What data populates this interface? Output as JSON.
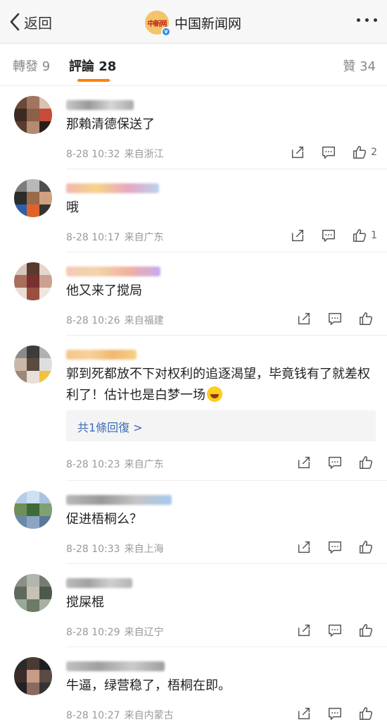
{
  "nav": {
    "back_label": "返回",
    "title": "中国新闻网",
    "logo_text": "中新网"
  },
  "tabs": {
    "repost": "轉發 9",
    "comments": "評論 28",
    "likes": "贊 34"
  },
  "colors": {
    "accent": "#ff8200",
    "link": "#3b6cb7",
    "verified": "#2f8fe6"
  },
  "comments": [
    {
      "text": "那賴清德保送了",
      "time": "8-28 10:32",
      "location": "来自浙江",
      "likes": "2"
    },
    {
      "text": "哦",
      "time": "8-28 10:17",
      "location": "来自广东",
      "likes": "1"
    },
    {
      "text": "他又来了搅局",
      "time": "8-28 10:26",
      "location": "来自福建",
      "likes": ""
    },
    {
      "text": "郭到死都放不下对权利的追逐渴望，毕竟钱有了就差权利了！估计也是白梦一场",
      "time": "8-28 10:23",
      "location": "来自广东",
      "likes": "",
      "replies": "共1條回復 >"
    },
    {
      "text": "促进梧桐么？",
      "time": "8-28 10:33",
      "location": "来自上海",
      "likes": ""
    },
    {
      "text": "搅屎棍",
      "time": "8-28 10:29",
      "location": "来自辽宁",
      "likes": ""
    },
    {
      "text": "牛逼，绿营稳了，梧桐在即。",
      "time": "8-28 10:27",
      "location": "来自内蒙古",
      "likes": ""
    }
  ],
  "icons": [
    "chevron-left-icon",
    "verified-icon",
    "more-icon",
    "share-icon",
    "comment-icon",
    "like-icon",
    "laughing-emoji-icon"
  ]
}
